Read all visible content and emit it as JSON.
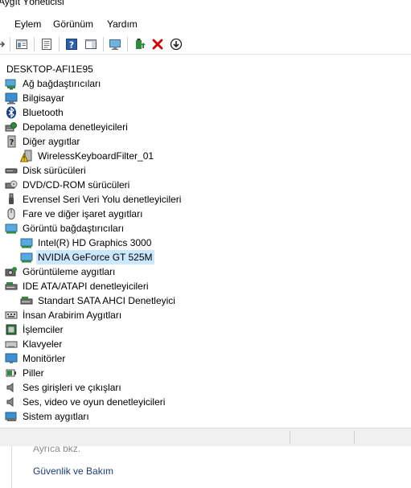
{
  "window": {
    "title": "Aygıt Yöneticisi"
  },
  "menu": [
    "Eylem",
    "Görünüm",
    "Yardım"
  ],
  "tree": {
    "root": "DESKTOP-AFI1E95",
    "items": [
      {
        "label": "Ağ bağdaştırıcıları",
        "icon": "network-adapter-icon",
        "level": 1
      },
      {
        "label": "Bilgisayar",
        "icon": "computer-icon",
        "level": 1
      },
      {
        "label": "Bluetooth",
        "icon": "bluetooth-icon",
        "level": 1
      },
      {
        "label": "Depolama denetleyicileri",
        "icon": "storage-controller-icon",
        "level": 1
      },
      {
        "label": "Diğer aygıtlar",
        "icon": "other-devices-icon",
        "level": 1
      },
      {
        "label": "WirelessKeyboardFilter_01",
        "icon": "warning-device-icon",
        "level": 2
      },
      {
        "label": "Disk sürücüleri",
        "icon": "disk-drive-icon",
        "level": 1
      },
      {
        "label": "DVD/CD-ROM sürücüleri",
        "icon": "dvd-drive-icon",
        "level": 1
      },
      {
        "label": "Evrensel Seri Veri Yolu denetleyicileri",
        "icon": "usb-icon",
        "level": 1
      },
      {
        "label": "Fare ve diğer işaret aygıtları",
        "icon": "mouse-icon",
        "level": 1
      },
      {
        "label": "Görüntü bağdaştırıcıları",
        "icon": "display-adapter-icon",
        "level": 1
      },
      {
        "label": "Intel(R) HD Graphics 3000",
        "icon": "display-adapter-icon",
        "level": 2
      },
      {
        "label": "NVIDIA GeForce GT 525M",
        "icon": "display-adapter-icon",
        "level": 2,
        "selected": true
      },
      {
        "label": "Görüntüleme aygıtları",
        "icon": "imaging-device-icon",
        "level": 1
      },
      {
        "label": "IDE ATA/ATAPI denetleyicileri",
        "icon": "ide-controller-icon",
        "level": 1
      },
      {
        "label": "Standart SATA AHCI Denetleyici",
        "icon": "ide-controller-icon",
        "level": 2
      },
      {
        "label": "İnsan Arabirim Aygıtları",
        "icon": "hid-icon",
        "level": 1
      },
      {
        "label": "İşlemciler",
        "icon": "processor-icon",
        "level": 1
      },
      {
        "label": "Klavyeler",
        "icon": "keyboard-icon",
        "level": 1
      },
      {
        "label": "Monitörler",
        "icon": "monitor-icon",
        "level": 1
      },
      {
        "label": "Piller",
        "icon": "battery-icon",
        "level": 1
      },
      {
        "label": "Ses girişleri ve çıkışları",
        "icon": "speaker-icon",
        "level": 1
      },
      {
        "label": "Ses, video ve oyun denetleyicileri",
        "icon": "speaker-icon",
        "level": 1
      },
      {
        "label": "Sistem aygıtları",
        "icon": "system-devices-icon",
        "level": 1
      }
    ]
  },
  "toolbar": [
    "back-icon",
    "forward-icon",
    "properties-icon",
    "show-hide-icon",
    "help-icon",
    "action-pane-icon",
    "scan-hardware-icon",
    "update-driver-icon",
    "uninstall-icon",
    "disable-device-icon"
  ],
  "below": {
    "see_also": "Ayrıca bkz.",
    "security_link": "Güvenlik ve Bakım"
  },
  "colors": {
    "selection": "#cce8ff",
    "link": "#1a3d7a",
    "uninstall_red": "#d40000"
  }
}
